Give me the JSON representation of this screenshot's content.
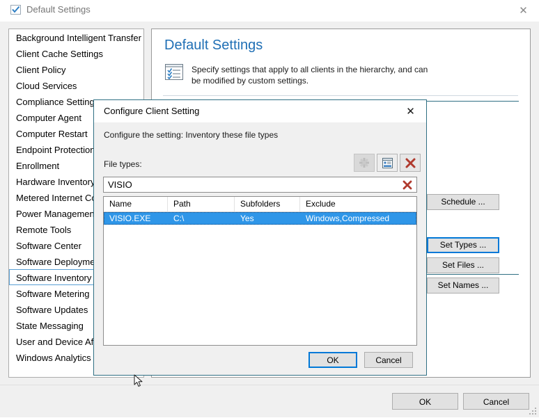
{
  "window": {
    "title": "Default Settings",
    "icon": "checkbox-checked-icon",
    "close_label": "✕"
  },
  "sidebar": {
    "items": [
      {
        "label": "Background Intelligent Transfer",
        "selected": false
      },
      {
        "label": "Client Cache Settings",
        "selected": false
      },
      {
        "label": "Client Policy",
        "selected": false
      },
      {
        "label": "Cloud Services",
        "selected": false
      },
      {
        "label": "Compliance Settings",
        "selected": false
      },
      {
        "label": "Computer Agent",
        "selected": false
      },
      {
        "label": "Computer Restart",
        "selected": false
      },
      {
        "label": "Endpoint Protection",
        "selected": false
      },
      {
        "label": "Enrollment",
        "selected": false
      },
      {
        "label": "Hardware Inventory",
        "selected": false
      },
      {
        "label": "Metered Internet Con",
        "selected": false
      },
      {
        "label": "Power Management",
        "selected": false
      },
      {
        "label": "Remote Tools",
        "selected": false
      },
      {
        "label": "Software Center",
        "selected": false
      },
      {
        "label": "Software Deployment",
        "selected": false
      },
      {
        "label": "Software Inventory",
        "selected": true
      },
      {
        "label": "Software Metering",
        "selected": false
      },
      {
        "label": "Software Updates",
        "selected": false
      },
      {
        "label": "State Messaging",
        "selected": false
      },
      {
        "label": "User and Device Affin",
        "selected": false
      },
      {
        "label": "Windows Analytics",
        "selected": false
      }
    ]
  },
  "panel": {
    "title": "Default Settings",
    "icon": "checklist-document-icon",
    "description": "Specify settings that apply to all clients in the hierarchy, and can be modified by custom settings.",
    "buttons": {
      "schedule": "Schedule ...",
      "set_types": "Set Types ...",
      "set_files": "Set Files ...",
      "set_names": "Set Names ..."
    },
    "focused_button": "set_types"
  },
  "footer": {
    "ok": "OK",
    "cancel": "Cancel"
  },
  "dialog": {
    "title": "Configure Client Setting",
    "close_label": "✕",
    "subtitle": "Configure the setting: Inventory these file types",
    "file_types_label": "File types:",
    "toolbar": [
      {
        "name": "new-icon",
        "enabled": false
      },
      {
        "name": "properties-icon",
        "enabled": true
      },
      {
        "name": "delete-icon",
        "enabled": true
      }
    ],
    "search": {
      "value": "VISIO",
      "placeholder": "",
      "clear_icon": "clear-red-x-icon"
    },
    "table": {
      "columns": [
        "Name",
        "Path",
        "Subfolders",
        "Exclude"
      ],
      "rows": [
        {
          "cells": [
            "VISIO.EXE",
            "C:\\",
            "Yes",
            "Windows,Compressed"
          ],
          "selected": true
        }
      ]
    },
    "buttons": {
      "ok": "OK",
      "cancel": "Cancel"
    },
    "focused_button": "ok"
  },
  "colors": {
    "accent_blue": "#0078d7",
    "title_blue": "#1f6fb5",
    "selection_blue": "#2f96e8",
    "delete_red": "#c0392b",
    "dialog_border": "#2f6f83"
  }
}
